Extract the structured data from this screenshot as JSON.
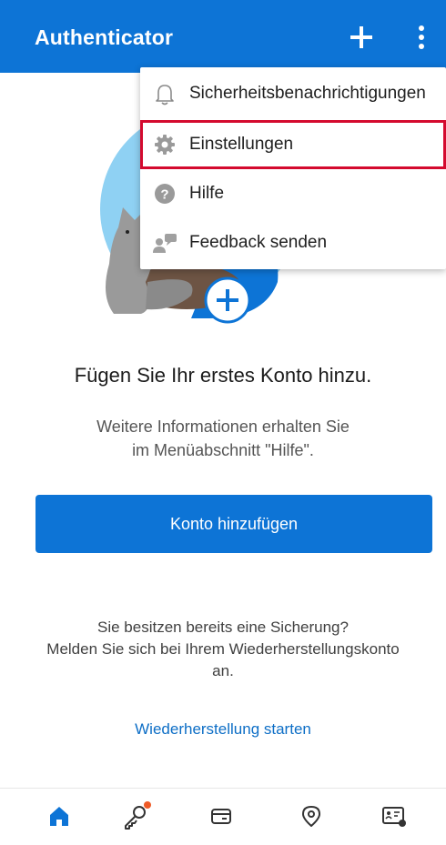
{
  "app": {
    "title": "Authenticator",
    "accent_color": "#0d74d6",
    "highlight_color": "#d40a2e"
  },
  "toolbar": {
    "add_icon": "plus-icon",
    "more_icon": "more-vertical-icon"
  },
  "menu": {
    "items": [
      {
        "label": "Sicherheitsbenachrichtigungen",
        "icon": "bell-icon"
      },
      {
        "label": "Einstellungen",
        "icon": "gear-icon",
        "highlighted": true
      },
      {
        "label": "Hilfe",
        "icon": "help-icon"
      },
      {
        "label": "Feedback senden",
        "icon": "feedback-icon"
      }
    ]
  },
  "main": {
    "headline": "Fügen Sie Ihr erstes Konto hinzu.",
    "subtext_line1": "Weitere Informationen erhalten Sie",
    "subtext_line2": "im Menüabschnitt \"Hilfe\".",
    "add_account_button": "Konto hinzufügen",
    "backup_line1": "Sie besitzen bereits eine Sicherung?",
    "backup_line2": "Melden Sie sich bei Ihrem Wiederherstellungskonto",
    "backup_line3": "an.",
    "recovery_link": "Wiederherstellung starten"
  },
  "bottom_nav": {
    "items": [
      {
        "icon": "home-icon",
        "active": true
      },
      {
        "icon": "key-icon",
        "badge": true
      },
      {
        "icon": "card-icon"
      },
      {
        "icon": "location-icon"
      },
      {
        "icon": "id-card-icon"
      }
    ]
  }
}
